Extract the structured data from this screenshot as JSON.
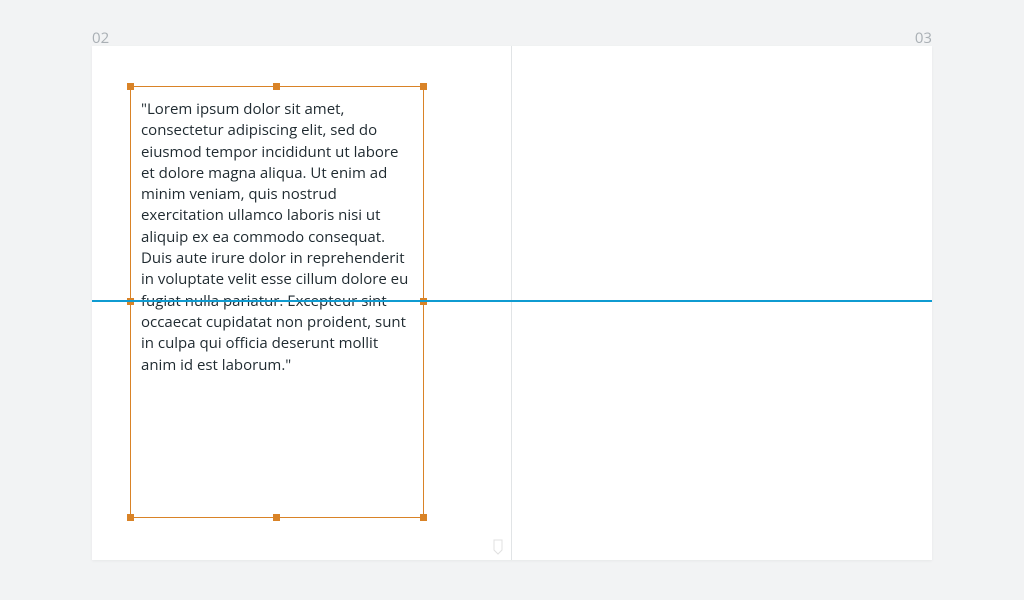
{
  "colors": {
    "selection": "#d98327",
    "guide": "#0f9bd1",
    "canvas_bg": "#f2f3f4",
    "page_bg": "#ffffff",
    "label": "#a9afb4"
  },
  "pages": {
    "left_label": "02",
    "right_label": "03"
  },
  "text_frame": {
    "content": "\"Lorem ipsum dolor sit amet, consectetur adipiscing elit, sed do eiusmod tempor incididunt ut labore et dolore magna aliqua. Ut enim ad minim veniam, quis nostrud exercitation ullamco laboris nisi ut aliquip ex ea commodo consequat. Duis aute irure dolor in reprehenderit in voluptate velit esse cillum dolore eu fugiat nulla pariatur. Excepteur sint occaecat cupidatat non proident, sunt in culpa qui officia deserunt mollit anim id est laborum.\""
  }
}
